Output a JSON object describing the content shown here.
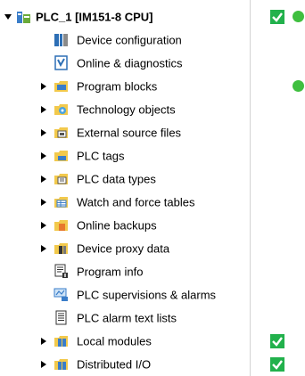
{
  "tree": {
    "root": {
      "label": "PLC_1 [IM151-8 CPU]",
      "checked": true,
      "online": true
    },
    "items": [
      {
        "label": "Device configuration"
      },
      {
        "label": "Online & diagnostics"
      },
      {
        "label": "Program blocks",
        "online": true
      },
      {
        "label": "Technology objects"
      },
      {
        "label": "External source files"
      },
      {
        "label": "PLC tags"
      },
      {
        "label": "PLC data types"
      },
      {
        "label": "Watch and force tables"
      },
      {
        "label": "Online backups"
      },
      {
        "label": "Device proxy data"
      },
      {
        "label": "Program info"
      },
      {
        "label": "PLC supervisions & alarms"
      },
      {
        "label": "PLC alarm text lists"
      },
      {
        "label": "Local modules",
        "checked": true
      },
      {
        "label": "Distributed I/O",
        "checked": true
      }
    ]
  },
  "colors": {
    "status_ok_green": "#3fbf3f",
    "check_fill": "#22b14c",
    "folder_yellow": "#f2c94c"
  }
}
